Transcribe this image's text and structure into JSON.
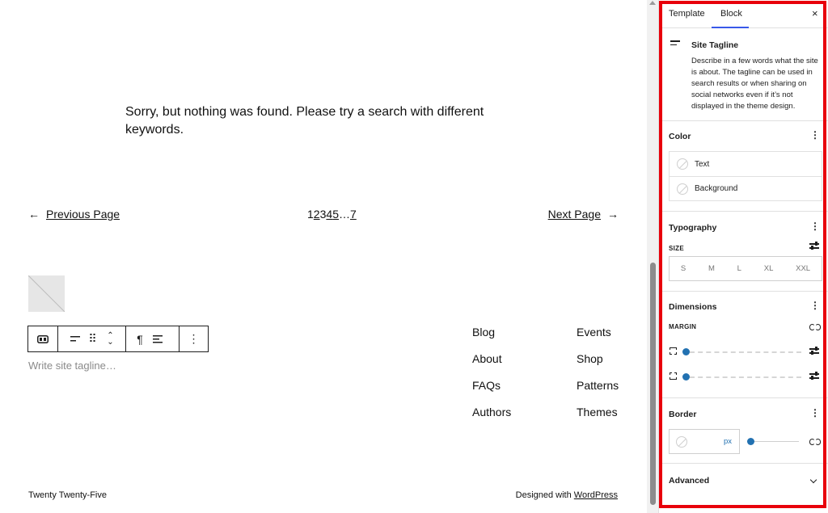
{
  "canvas": {
    "no_results": "Sorry, but nothing was found. Please try a search with different keywords.",
    "pagination": {
      "prev_arrow": "←",
      "prev_label": "Previous Page",
      "pages": [
        "1",
        "2",
        "3",
        "4",
        "5",
        "…",
        "7"
      ],
      "next_label": "Next Page",
      "next_arrow": "→"
    },
    "toolbar": {
      "align_icon": "align-left-icon",
      "drag_glyph": "⠿",
      "up_glyph": "⌃",
      "down_glyph": "⌄",
      "paragraph_glyph": "¶",
      "more_glyph": "⋮"
    },
    "tagline_placeholder": "Write site tagline…",
    "footer_nav": {
      "col1": [
        "Blog",
        "About",
        "FAQs",
        "Authors"
      ],
      "col2": [
        "Events",
        "Shop",
        "Patterns",
        "Themes"
      ]
    },
    "footer": {
      "site_name": "Twenty Twenty-Five",
      "designed_with": "Designed with ",
      "wordpress": "WordPress"
    }
  },
  "sidebar": {
    "tabs": {
      "template": "Template",
      "block": "Block",
      "close": "×"
    },
    "block_card": {
      "title": "Site Tagline",
      "description": "Describe in a few words what the site is about. The tagline can be used in search results or when sharing on social networks even if it’s not displayed in the theme design."
    },
    "color": {
      "title": "Color",
      "menu": "⋮",
      "items": [
        "Text",
        "Background"
      ]
    },
    "typography": {
      "title": "Typography",
      "menu": "⋮",
      "size_label": "SIZE",
      "sizes": [
        "S",
        "M",
        "L",
        "XL",
        "XXL"
      ]
    },
    "dimensions": {
      "title": "Dimensions",
      "menu": "⋮",
      "margin_label": "MARGIN"
    },
    "border": {
      "title": "Border",
      "menu": "⋮",
      "unit": "px"
    },
    "advanced": {
      "title": "Advanced"
    }
  },
  "colors": {
    "accent": "#3858e9",
    "highlight": "#e8000b",
    "slider": "#2271b1"
  }
}
